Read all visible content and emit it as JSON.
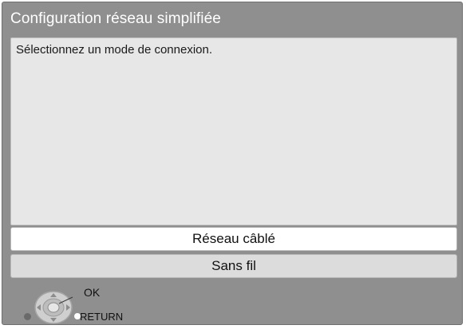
{
  "title": "Configuration réseau simplifiée",
  "prompt": "Sélectionnez un mode de connexion.",
  "options": [
    {
      "label": "Réseau câblé",
      "selected": true
    },
    {
      "label": "Sans fil",
      "selected": false
    }
  ],
  "legend": {
    "ok_label": "OK",
    "return_label": "RETURN"
  },
  "icons": [
    "navigation-dial-icon",
    "return-dot-icon"
  ]
}
